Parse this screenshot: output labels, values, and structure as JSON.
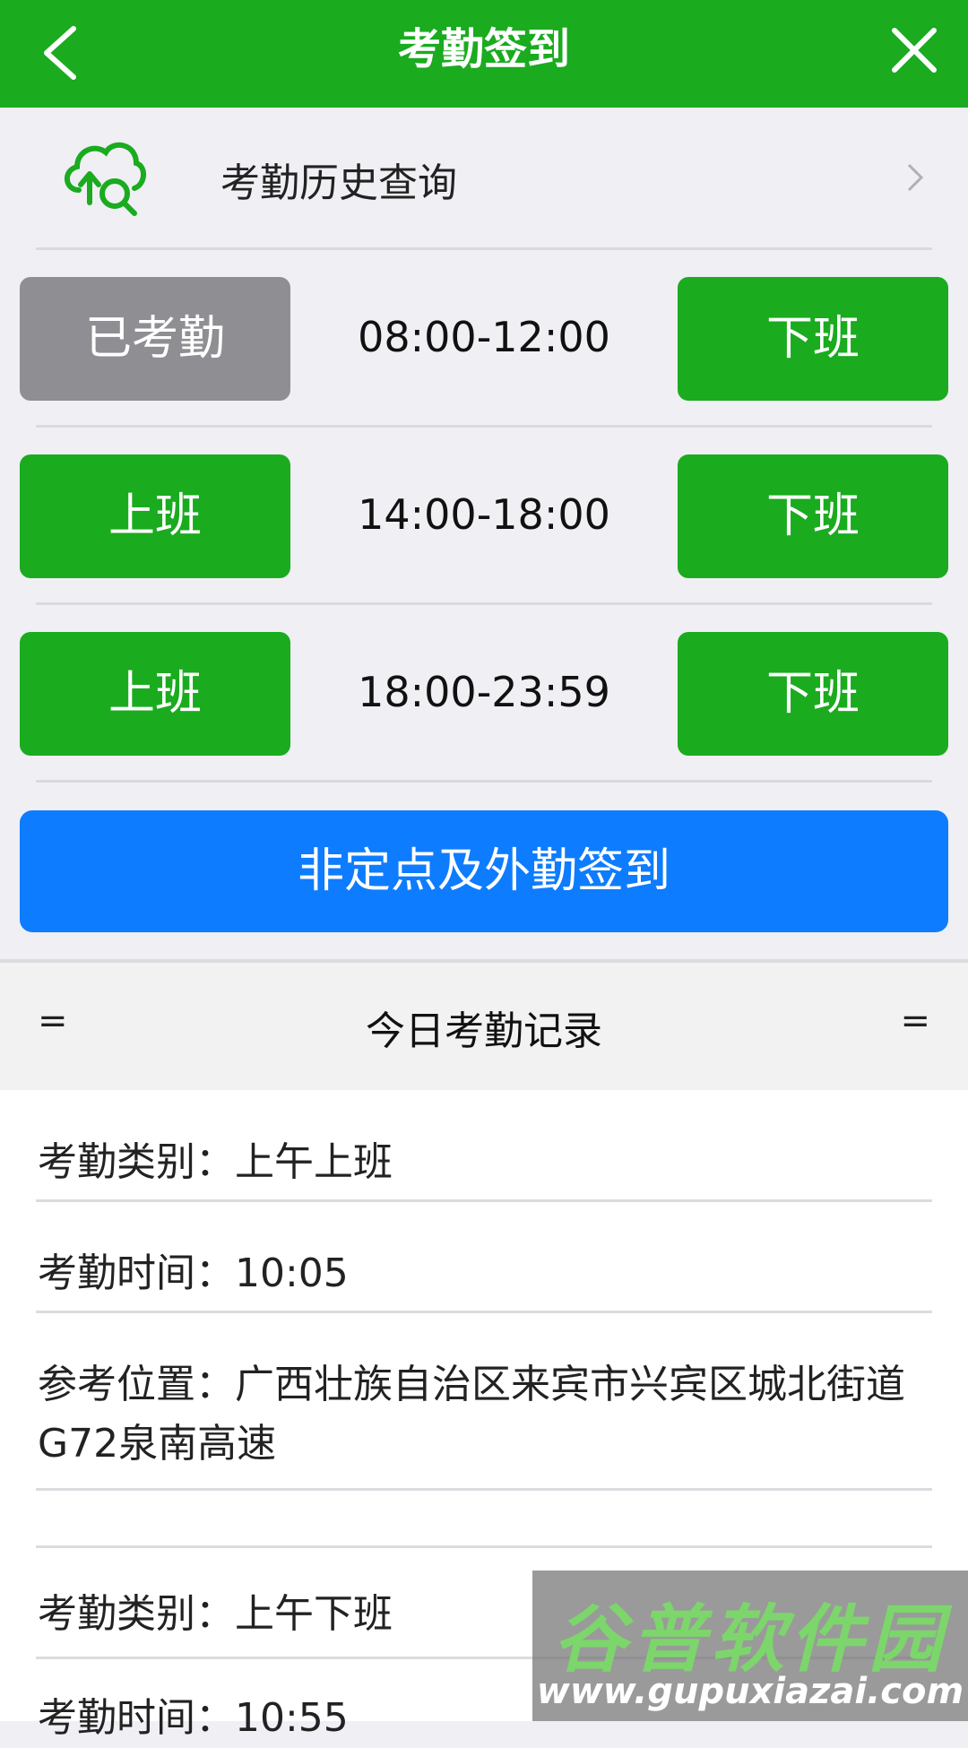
{
  "header": {
    "title": "考勤签到"
  },
  "history": {
    "label": "考勤历史查询"
  },
  "shifts": [
    {
      "left_label": "已考勤",
      "time": "08:00-12:00",
      "right_label": "下班"
    },
    {
      "left_label": "上班",
      "time": "14:00-18:00",
      "right_label": "下班"
    },
    {
      "left_label": "上班",
      "time": "18:00-23:59",
      "right_label": "下班"
    }
  ],
  "outwork_label": "非定点及外勤签到",
  "records_header": {
    "left_mark": "=",
    "title": "今日考勤记录",
    "right_mark": "="
  },
  "records": [
    {
      "text": "考勤类别：上午上班"
    },
    {
      "text": "考勤时间：10:05"
    },
    {
      "text": "参考位置：广西壮族自治区来宾市兴宾区城北街道"
    },
    {
      "text": "G72泉南高速"
    },
    {
      "text": "考勤类别：上午下班"
    },
    {
      "text": "考勤时间：10:55"
    }
  ],
  "watermark": {
    "title": "谷普软件园",
    "url": "www.gupuxiazai.com"
  },
  "colors": {
    "primary_green": "#1aab1f",
    "disabled_gray": "#8e8e93",
    "action_blue": "#0e7cff"
  }
}
